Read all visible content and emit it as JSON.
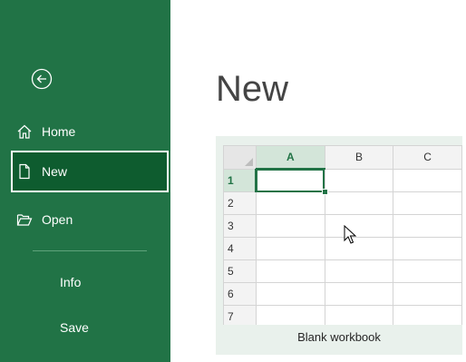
{
  "sidebar": {
    "items": [
      {
        "label": "Home",
        "icon": "home-icon"
      },
      {
        "label": "New",
        "icon": "new-document-icon",
        "selected": true
      },
      {
        "label": "Open",
        "icon": "folder-open-icon"
      },
      {
        "label": "Info"
      },
      {
        "label": "Save"
      }
    ],
    "back_icon": "back-arrow-icon",
    "bg_color": "#217346",
    "selected_color": "#0e5c2f"
  },
  "main": {
    "title": "New",
    "template": {
      "label": "Blank workbook",
      "columns": [
        "A",
        "B",
        "C"
      ],
      "rows": [
        "1",
        "2",
        "3",
        "4",
        "5",
        "6",
        "7"
      ],
      "selected_cell": "A1",
      "accent_color": "#217346"
    }
  }
}
